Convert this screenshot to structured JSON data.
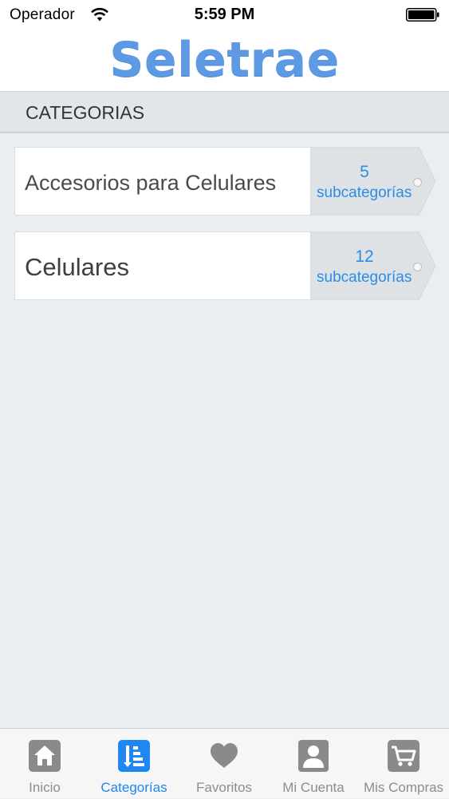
{
  "status_bar": {
    "carrier": "Operador",
    "time": "5:59 PM"
  },
  "header": {
    "logo": "Seletrae"
  },
  "section": {
    "title": "CATEGORIAS"
  },
  "categories": [
    {
      "name": "Accesorios para Celulares",
      "count": "5",
      "sub_label": "subcategorías"
    },
    {
      "name": "Celulares",
      "count": "12",
      "sub_label": "subcategorías"
    }
  ],
  "tabs": [
    {
      "label": "Inicio",
      "icon": "home-icon",
      "active": false
    },
    {
      "label": "Categorías",
      "icon": "categories-list-icon",
      "active": true
    },
    {
      "label": "Favoritos",
      "icon": "heart-icon",
      "active": false
    },
    {
      "label": "Mi Cuenta",
      "icon": "user-icon",
      "active": false
    },
    {
      "label": "Mis Compras",
      "icon": "cart-icon",
      "active": false
    }
  ],
  "colors": {
    "accent": "#1f86f2",
    "logo": "#5d9ae3",
    "tab_inactive": "#8d8d8d",
    "background": "#eaeef1"
  }
}
